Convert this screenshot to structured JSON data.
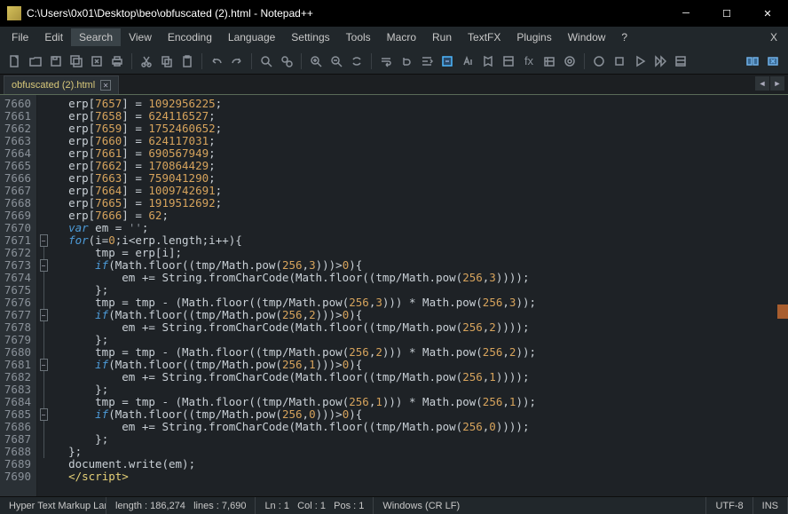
{
  "titlebar": {
    "path": "C:\\Users\\0x01\\Desktop\\beo\\obfuscated (2).html - Notepad++"
  },
  "menu": {
    "items": [
      "File",
      "Edit",
      "Search",
      "View",
      "Encoding",
      "Language",
      "Settings",
      "Tools",
      "Macro",
      "Run",
      "TextFX",
      "Plugins",
      "Window",
      "?"
    ],
    "highlighted": "Search",
    "x": "X"
  },
  "tabs": {
    "active": "obfuscated (2).html"
  },
  "lines": [
    7660,
    7661,
    7662,
    7663,
    7664,
    7665,
    7666,
    7667,
    7668,
    7669,
    7670,
    7671,
    7672,
    7673,
    7674,
    7675,
    7676,
    7677,
    7678,
    7679,
    7680,
    7681,
    7682,
    7683,
    7684,
    7685,
    7686,
    7687,
    7688,
    7689,
    7690
  ],
  "code": {
    "assigns": [
      {
        "idx": "7657",
        "val": "1092956225"
      },
      {
        "idx": "7658",
        "val": "624116527"
      },
      {
        "idx": "7659",
        "val": "1752460652"
      },
      {
        "idx": "7660",
        "val": "624117031"
      },
      {
        "idx": "7661",
        "val": "690567949"
      },
      {
        "idx": "7662",
        "val": "170864429"
      },
      {
        "idx": "7663",
        "val": "759041290"
      },
      {
        "idx": "7664",
        "val": "1009742691"
      },
      {
        "idx": "7665",
        "val": "1919512692"
      },
      {
        "idx": "7666",
        "val": "62"
      }
    ],
    "var_em": "var",
    "em_name": "em",
    "em_val": "''",
    "for_kw": "for",
    "for_cond_a": "i",
    "for_cond_b": "erp",
    "for_cond_c": "length",
    "tmp": "tmp",
    "erp": "erp",
    "i": "i",
    "if_kw": "if",
    "math": "Math",
    "floor": "floor",
    "pow": "pow",
    "n256": "256",
    "exp3": "3",
    "exp2": "2",
    "exp1": "1",
    "exp0": "0",
    "zero": "0",
    "string": "String",
    "fcc": "fromCharCode",
    "doc": "document",
    "write": "write",
    "script_end": "</script>"
  },
  "status": {
    "lang": "Hyper Text Markup Lan",
    "length_label": "length :",
    "length_val": "186,274",
    "lines_label": "lines :",
    "lines_val": "7,690",
    "ln": "Ln : 1",
    "col": "Col : 1",
    "pos": "Pos : 1",
    "eol": "Windows (CR LF)",
    "enc": "UTF-8",
    "ins": "INS"
  }
}
